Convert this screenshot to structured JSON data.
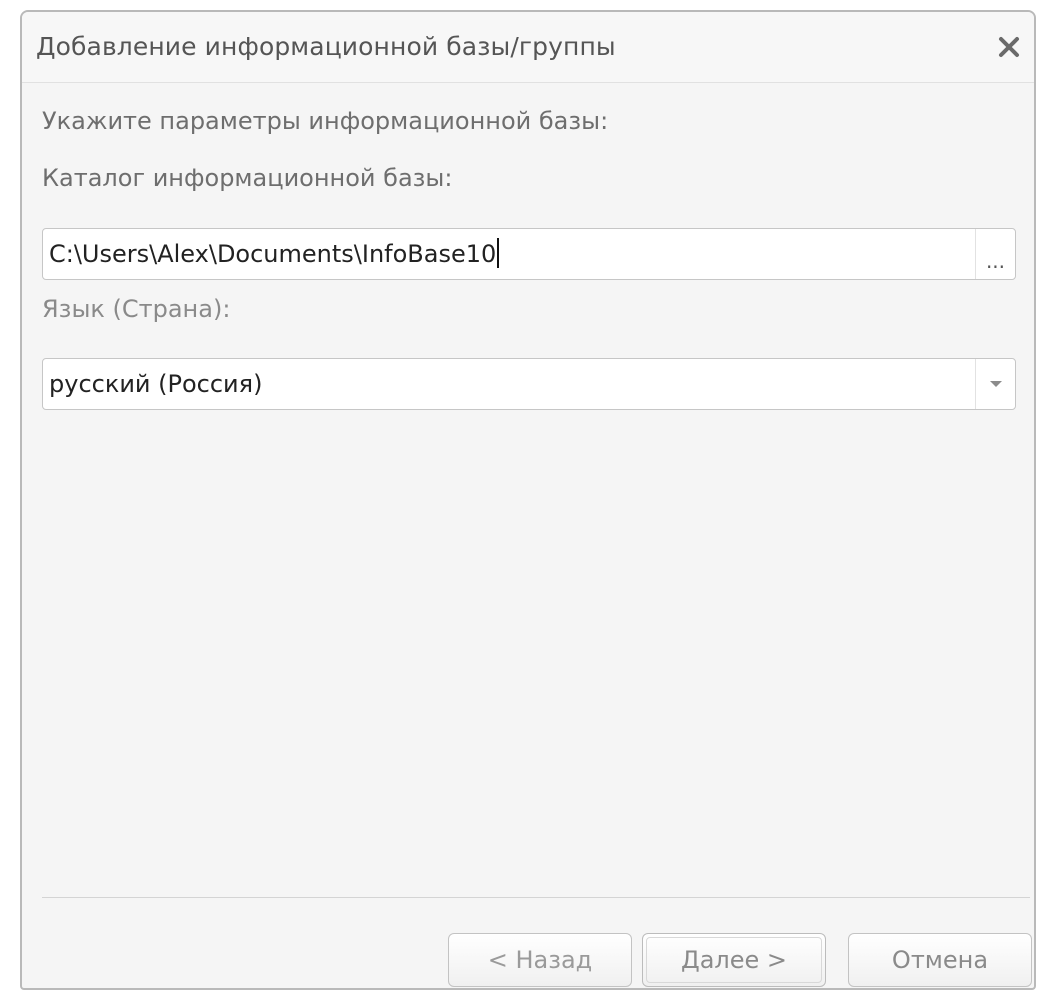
{
  "dialog": {
    "title": "Добавление информационной базы/группы",
    "close_icon": "close-icon"
  },
  "form": {
    "params_label": "Укажите параметры информационной базы:",
    "catalog_label": "Каталог информационной базы:",
    "catalog_value": "C:\\Users\\Alex\\Documents\\InfoBase10",
    "browse_label": "...",
    "language_label": "Язык (Страна):",
    "language_value": "русский (Россия)",
    "language_dropdown_icon": "chevron-down-icon"
  },
  "buttons": {
    "back_label": "< Назад",
    "next_label": "Далее >",
    "cancel_label": "Отмена"
  }
}
